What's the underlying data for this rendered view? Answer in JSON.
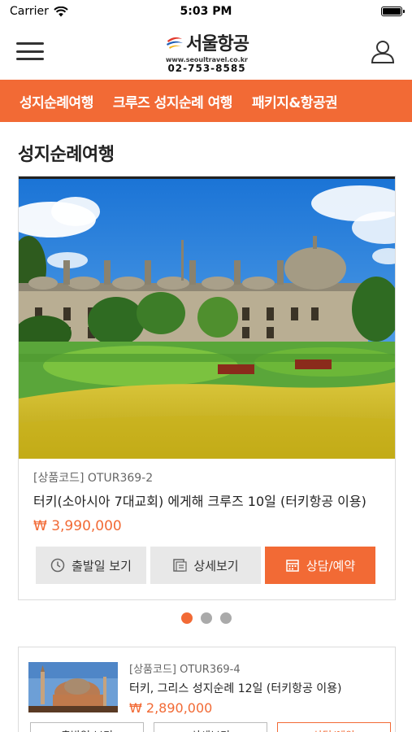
{
  "status_bar": {
    "carrier": "Carrier",
    "time": "5:03 PM"
  },
  "header": {
    "logo_text": "서울항공",
    "logo_url": "www.seoultravel.co.kr",
    "logo_phone": "02-753-8585"
  },
  "nav": {
    "items": [
      {
        "label": "성지순례여행"
      },
      {
        "label": "크루즈 성지순례 여행"
      },
      {
        "label": "패키지&항공권"
      }
    ]
  },
  "section": {
    "title": "성지순례여행"
  },
  "featured": {
    "product_code": "[상품코드] OTUR369-2",
    "title": "터키(소아시아 7대교회) 에게해 크루즈 10일 (터키항공 이용)",
    "price": "₩ 3,990,000",
    "buttons": {
      "departure": "출발일 보기",
      "detail": "상세보기",
      "consult": "상담/예약"
    }
  },
  "carousel": {
    "active_index": 0,
    "count": 3
  },
  "second": {
    "product_code": "[상품코드] OTUR369-4",
    "title": "터키, 그리스 성지순례 12일 (터키항공 이용)",
    "price": "₩ 2,890,000",
    "buttons": {
      "departure": "출발일 보기",
      "detail": "상세보기",
      "consult": "상담/예약"
    }
  },
  "colors": {
    "accent": "#f26a35",
    "button_gray": "#e8e8e8"
  }
}
